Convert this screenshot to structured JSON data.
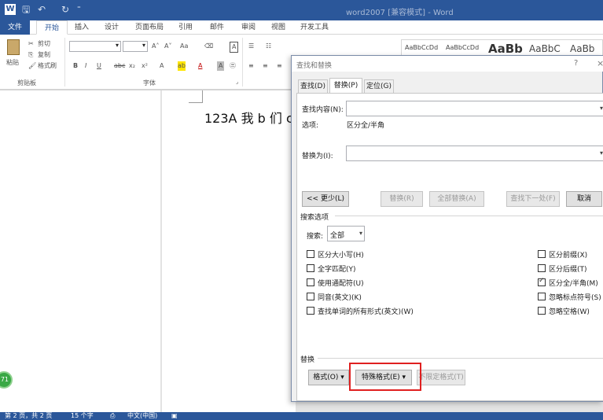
{
  "titlebar": {
    "title": "word2007 [兼容模式] - Word",
    "app_icon": "W",
    "save_glyph": "🖫",
    "undo_glyph": "↶",
    "redo_glyph": "↻",
    "qat_more": "⁼"
  },
  "tabs": [
    "文件",
    "开始",
    "插入",
    "设计",
    "页面布局",
    "引用",
    "邮件",
    "审阅",
    "视图",
    "开发工具"
  ],
  "ribbon": {
    "clipboard": {
      "paste": "粘贴",
      "cut": "剪切",
      "copy": "复制",
      "format_painter": "格式刷",
      "group": "剪贴板"
    },
    "font": {
      "grow": "A˄",
      "shrink": "A˅",
      "case": "Aa",
      "bold": "B",
      "italic": "I",
      "underline": "U",
      "strike": "abc",
      "subscript": "x₂",
      "superscript": "x²",
      "group": "字体"
    },
    "styles": [
      "AaBbCcDd",
      "AaBbCcDd",
      "AaBb",
      "AaBbC",
      "AaBb"
    ]
  },
  "document": {
    "text": "123A 我 b 们 c"
  },
  "badge": "71",
  "statusbar": {
    "page": "第 2 页，共 2 页",
    "words": "15 个字",
    "language": "中文(中国)"
  },
  "dialog": {
    "title": "查找和替换",
    "help": "?",
    "close": "×",
    "tabs": [
      "查找(D)",
      "替换(P)",
      "定位(G)"
    ],
    "find_label": "查找内容(N):",
    "options_label": "选项:",
    "options_value": "区分全/半角",
    "replace_label": "替换为(I):",
    "btn_less": "<< 更少(L)",
    "btn_replace": "替换(R)",
    "btn_replace_all": "全部替换(A)",
    "btn_find_next": "查找下一处(F)",
    "btn_cancel": "取消",
    "search_options_title": "搜索选项",
    "search_label": "搜索:",
    "search_value": "全部",
    "left_options": [
      {
        "label": "区分大小写(H)",
        "checked": false
      },
      {
        "label": "全字匹配(Y)",
        "checked": false
      },
      {
        "label": "使用通配符(U)",
        "checked": false
      },
      {
        "label": "同音(英文)(K)",
        "checked": false
      },
      {
        "label": "查找单词的所有形式(英文)(W)",
        "checked": false
      }
    ],
    "right_options": [
      {
        "label": "区分前缀(X)",
        "checked": false
      },
      {
        "label": "区分后缀(T)",
        "checked": false
      },
      {
        "label": "区分全/半角(M)",
        "checked": true
      },
      {
        "label": "忽略标点符号(S)",
        "checked": false
      },
      {
        "label": "忽略空格(W)",
        "checked": false
      }
    ],
    "replace_section": "替换",
    "btn_format": "格式(O) ▾",
    "btn_special": "特殊格式(E) ▾",
    "btn_no_format": "不限定格式(T)"
  },
  "colors": {
    "accent": "#2b579a",
    "highlight": "#e02020"
  }
}
